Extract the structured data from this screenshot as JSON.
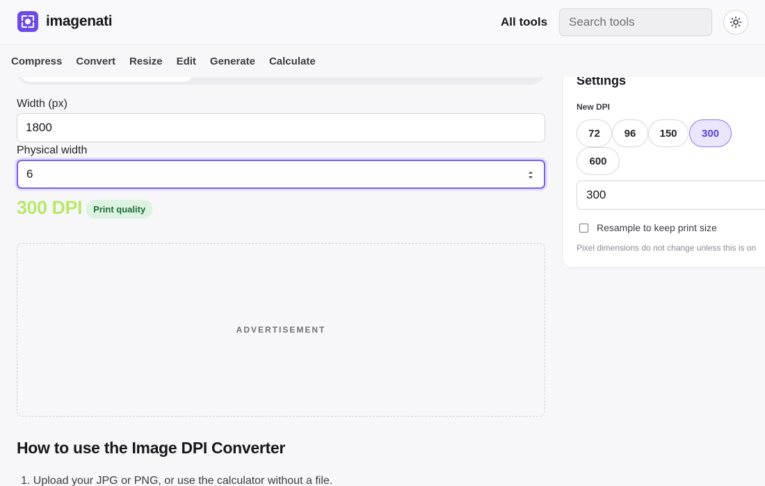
{
  "header": {
    "brand": "imagenati",
    "all_tools": "All tools",
    "search_placeholder": "Search tools"
  },
  "nav": {
    "items": [
      "Compress",
      "Convert",
      "Resize",
      "Edit",
      "Generate",
      "Calculate"
    ]
  },
  "form": {
    "width_label": "Width (px)",
    "width_value": "1800",
    "physical_label": "Physical width",
    "physical_value": "6",
    "result_dpi": "300 DPI",
    "result_badge": "Print quality"
  },
  "ad": {
    "label": "ADVERTISEMENT"
  },
  "howto": {
    "title": "How to use the Image DPI Converter",
    "step1": "1. Upload your JPG or PNG, or use the calculator without a file."
  },
  "settings": {
    "title": "Settings",
    "new_dpi_label": "New DPI",
    "presets": [
      "72",
      "96",
      "150",
      "300",
      "600"
    ],
    "selected_preset": "300",
    "dpi_value": "300",
    "resample_label": "Resample to keep print size",
    "resample_checked": false,
    "hint": "Pixel dimensions do not change unless this is on"
  },
  "colors": {
    "accent": "#6d4ce6",
    "dpi_result": "#b9e86a",
    "badge_bg": "#ddf3e2",
    "badge_text": "#1f6b35"
  },
  "icons": {
    "logo": "camera-focus-icon",
    "theme": "sun-icon",
    "spinner": "number-spinner-icon"
  }
}
